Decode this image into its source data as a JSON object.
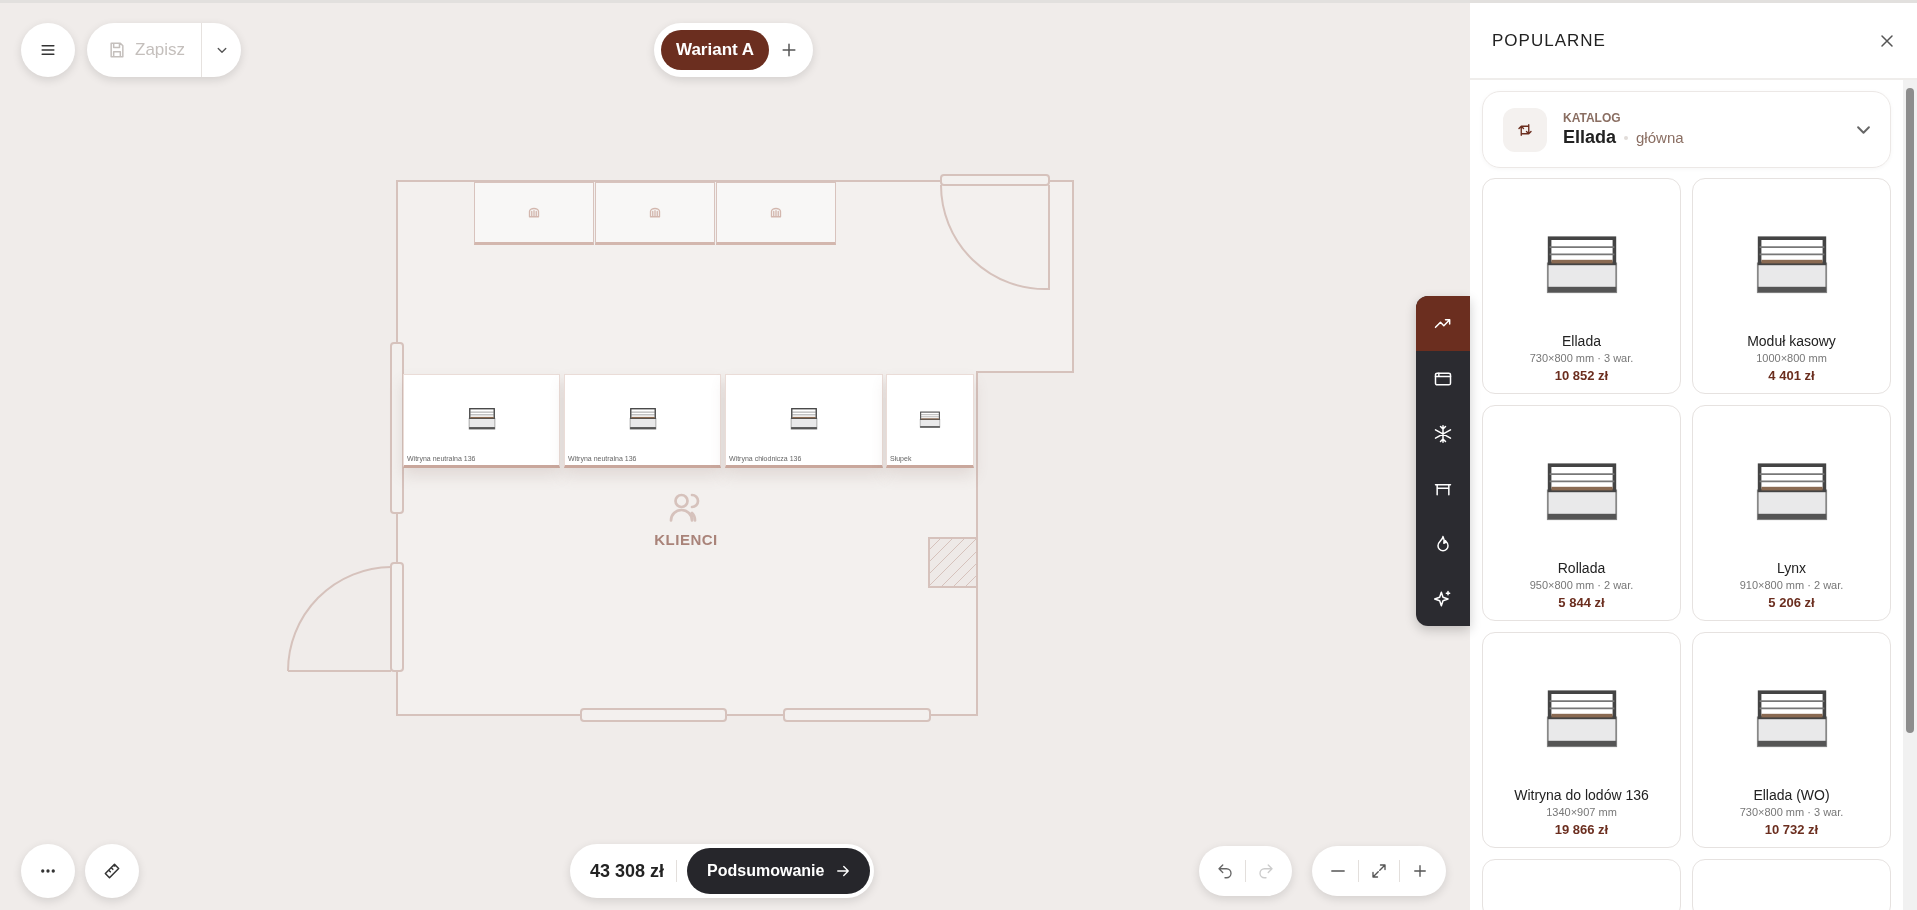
{
  "toolbar": {
    "save": {
      "label": "Zapisz",
      "disabled": true
    }
  },
  "variants": [
    {
      "label": "Wariant A",
      "selected": true
    }
  ],
  "plan": {
    "counters": [
      {
        "label": "Witryna neutralna 136"
      },
      {
        "label": "Witryna neutralna 136"
      },
      {
        "label": "Witryna chłodnicza 136"
      },
      {
        "label": "Słupek"
      }
    ],
    "zone_label": "KLIENCI"
  },
  "footer": {
    "total": "43 308 zł",
    "summary_button": "Podsumowanie",
    "undo": {
      "disabled": false
    },
    "redo": {
      "disabled": true
    }
  },
  "panel": {
    "title": "POPULARNE",
    "catalog": {
      "label": "KATALOG",
      "name": "Ellada",
      "variant": "główna"
    },
    "categories": [
      {
        "selected": true
      },
      {
        "selected": false
      },
      {
        "selected": false
      },
      {
        "selected": false
      },
      {
        "selected": false
      },
      {
        "selected": false
      }
    ],
    "products": [
      {
        "name": "Ellada",
        "spec": "730×800 mm · 3 war.",
        "price": "10 852 zł"
      },
      {
        "name": "Moduł kasowy",
        "spec": "1000×800 mm",
        "price": "4 401 zł"
      },
      {
        "name": "Rollada",
        "spec": "950×800 mm · 2 war.",
        "price": "5 844 zł"
      },
      {
        "name": "Lynx",
        "spec": "910×800 mm · 2 war.",
        "price": "5 206 zł"
      },
      {
        "name": "Witryna do lodów 136",
        "spec": "1340×907 mm",
        "price": "19 866 zł"
      },
      {
        "name": "Ellada (WO)",
        "spec": "730×800 mm · 3 war.",
        "price": "10 732 zł"
      }
    ]
  }
}
